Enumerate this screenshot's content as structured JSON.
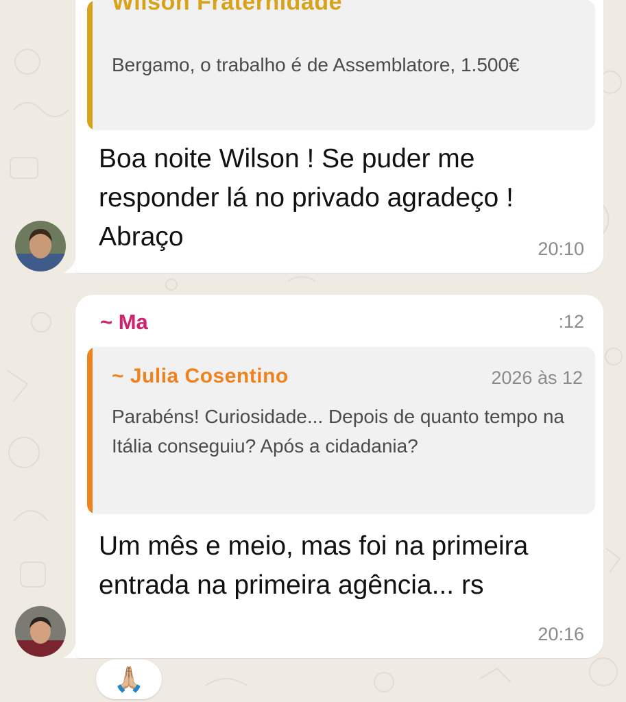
{
  "messages": [
    {
      "quote": {
        "author": "Wilson Fraternidade",
        "text": "Bergamo,  o trabalho é de Assemblatore, 1.500€",
        "bar_color": "#d7a31b"
      },
      "text": "Boa noite Wilson ! Se puder me responder lá no privado agradeço ! Abraço",
      "time": "20:10"
    },
    {
      "sender": "~ Ma",
      "header_time": ":12",
      "quote": {
        "author": "~ Julia Cosentino",
        "meta": "2026 às 12",
        "text": "Parabéns! Curiosidade... Depois de quanto tempo na Itália conseguiu? Após a cidadania?",
        "bar_color": "#f0821e"
      },
      "text": "Um mês e meio, mas foi na primeira entrada na primeira agência... rs",
      "time": "20:16",
      "reaction": "🙏🏼"
    }
  ],
  "colors": {
    "background": "#efeae2",
    "bubble": "#ffffff",
    "quote_bg": "#f1f1f2",
    "sender_magenta": "#d2206e",
    "timestamp": "#8b8b8b"
  },
  "icons": [
    "avatar-photo",
    "folded-hands-emoji"
  ]
}
